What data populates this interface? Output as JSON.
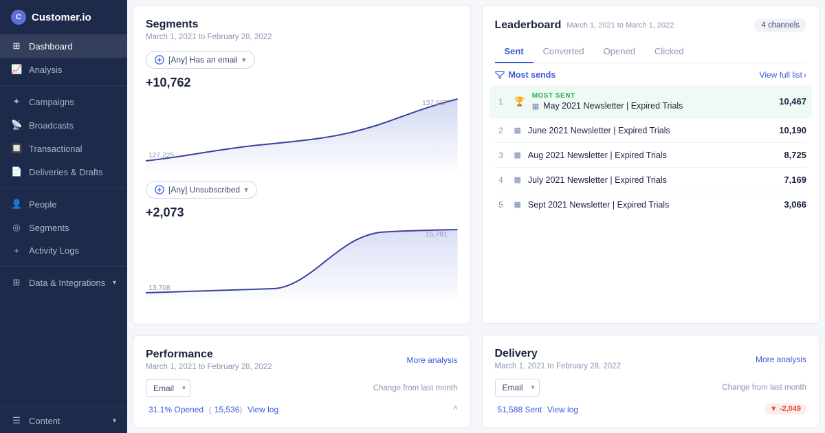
{
  "sidebar": {
    "logo": "Customer.io",
    "logo_initial": "C",
    "items": [
      {
        "label": "Dashboard",
        "icon": "⊞",
        "active": true
      },
      {
        "label": "Analysis",
        "icon": "📊",
        "active": false
      }
    ],
    "campaigns_section": [
      {
        "label": "Campaigns",
        "icon": "✦"
      },
      {
        "label": "Broadcasts",
        "icon": "📡"
      },
      {
        "label": "Transactional",
        "icon": "🔲"
      },
      {
        "label": "Deliveries & Drafts",
        "icon": "📄"
      }
    ],
    "people_section": [
      {
        "label": "People",
        "icon": "👤"
      },
      {
        "label": "Segments",
        "icon": "◎"
      },
      {
        "label": "Activity Logs",
        "icon": "+"
      }
    ],
    "data_section": [
      {
        "label": "Data & Integrations",
        "icon": "⊞",
        "has_chevron": true
      }
    ],
    "bottom_section": [
      {
        "label": "Content",
        "icon": "☰",
        "has_chevron": true
      }
    ]
  },
  "segments_card": {
    "title": "Segments",
    "date_range": "March 1, 2021 to February 28, 2022",
    "filter1": {
      "label": "[Any] Has an email",
      "value": "+10,762"
    },
    "filter2": {
      "label": "[Any] Unsubscribed",
      "value": "+2,073"
    },
    "chart1": {
      "start_val": "127,225",
      "end_val": "137,987",
      "points": [
        0,
        5,
        8,
        12,
        15,
        20,
        25,
        30,
        35,
        40,
        48,
        55,
        65,
        75,
        90,
        100
      ]
    },
    "chart2": {
      "start_val": "13,708",
      "end_val": "15,781",
      "points": [
        0,
        2,
        3,
        4,
        5,
        6,
        7,
        8,
        10,
        30,
        60,
        75,
        80,
        82,
        83,
        85,
        88,
        90,
        92,
        95,
        98,
        100
      ]
    }
  },
  "leaderboard_card": {
    "title": "Leaderboard",
    "date_range": "March 1, 2021 to March 1, 2022",
    "channels_label": "4 channels",
    "tabs": [
      "Sent",
      "Converted",
      "Opened",
      "Clicked"
    ],
    "active_tab": "Sent",
    "most_sends_label": "Most sends",
    "view_full_list": "View full list",
    "rows": [
      {
        "rank": 1,
        "name": "May 2021 Newsletter | Expired Trials",
        "value": "10,467",
        "highlighted": true,
        "badge": "MOST SENT"
      },
      {
        "rank": 2,
        "name": "June 2021 Newsletter | Expired Trials",
        "value": "10,190"
      },
      {
        "rank": 3,
        "name": "Aug 2021 Newsletter | Expired Trials",
        "value": "8,725"
      },
      {
        "rank": 4,
        "name": "July 2021 Newsletter | Expired Trials",
        "value": "7,169"
      },
      {
        "rank": 5,
        "name": "Sept 2021 Newsletter | Expired Trials",
        "value": "3,066"
      }
    ]
  },
  "performance_card": {
    "title": "Performance",
    "date_range": "March 1, 2021 to February 28, 2022",
    "more_analysis": "More analysis",
    "dropdown_value": "Email",
    "change_label": "Change from last month",
    "stat_label": "31.1% Opened",
    "stat_count": "15,536",
    "stat_link": "View log"
  },
  "delivery_card": {
    "title": "Delivery",
    "date_range": "March 1, 2021 to February 28, 2022",
    "more_analysis": "More analysis",
    "dropdown_value": "Email",
    "change_label": "Change from last month",
    "stat_label": "51,588 Sent",
    "stat_link": "View log",
    "delta_value": "-2,049",
    "delta_icon": "▼"
  }
}
